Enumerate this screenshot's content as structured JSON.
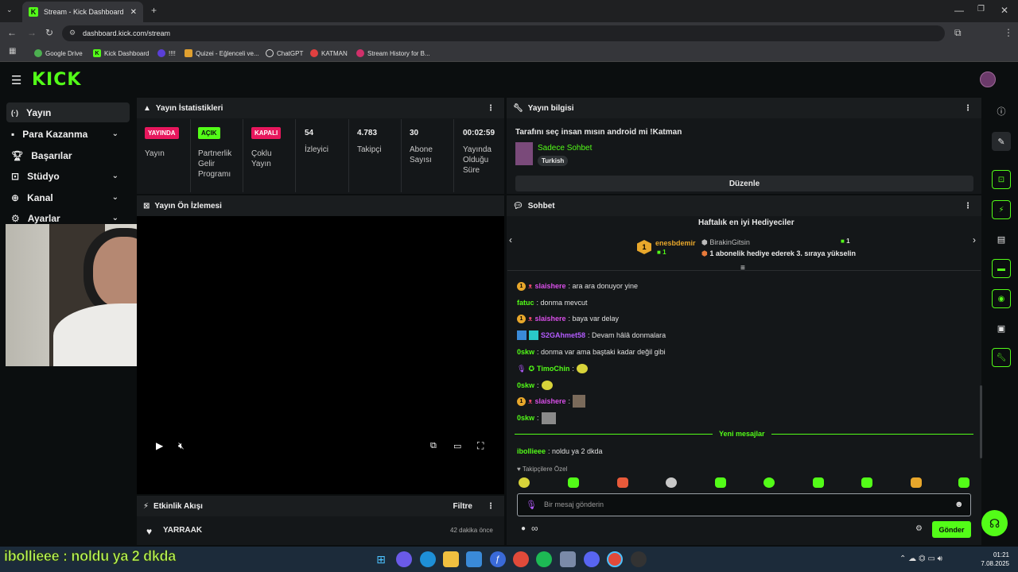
{
  "browser": {
    "tab_title": "Stream - Kick Dashboard",
    "url": "dashboard.kick.com/stream",
    "bookmarks": [
      "Google Drive",
      "Kick Dashboard",
      "!!!!",
      "Quizei - Eğlenceli ve...",
      "ChatGPT",
      "KATMAN",
      "Stream History for B..."
    ]
  },
  "sidebar": {
    "items": [
      {
        "label": "Yayın",
        "icon": "broadcast-icon"
      },
      {
        "label": "Para Kazanma",
        "icon": "money-icon"
      },
      {
        "label": "Başarılar",
        "icon": "trophy-icon"
      },
      {
        "label": "Stüdyo",
        "icon": "studio-icon"
      },
      {
        "label": "Kanal",
        "icon": "channel-icon"
      },
      {
        "label": "Ayarlar",
        "icon": "settings-icon"
      }
    ]
  },
  "stats": {
    "title": "Yayın İstatistikleri",
    "badges": [
      {
        "badge": "YAYINDA",
        "label": "Yayın",
        "color": "#e8175d"
      },
      {
        "badge": "AÇIK",
        "label": "Partnerlik Gelir Programı",
        "color": "#53fc18"
      },
      {
        "badge": "KAPALI",
        "label": "Çoklu Yayın",
        "color": "#e8175d"
      }
    ],
    "values": [
      {
        "value": "54",
        "label": "İzleyici"
      },
      {
        "value": "4.783",
        "label": "Takipçi"
      },
      {
        "value": "30",
        "label": "Abone Sayısı"
      },
      {
        "value": "00:02:59",
        "label": "Yayında Olduğu Süre"
      }
    ]
  },
  "preview": {
    "title": "Yayın Ön İzlemesi"
  },
  "activity": {
    "title": "Etkinlik Akışı",
    "filter": "Filtre",
    "item_user": "YARRAAK",
    "item_time": "42 dakika önce"
  },
  "info": {
    "title": "Yayın bilgisi",
    "stream_title": "Tarafını seç insan mısın android mi !Katman",
    "category": "Sadece Sohbet",
    "tag": "Turkish",
    "edit": "Düzenle"
  },
  "chat": {
    "title": "Sohbet",
    "gifters_title": "Haftalık en iyi Hediyeciler",
    "top_gifter": "enesbdemir",
    "top_count": "1",
    "second_gifter": "BirakinGitsin",
    "second_count": "1",
    "second_note": "1 abonelik hediye ederek 3. sıraya yükselin",
    "messages": [
      {
        "user": "slaishere",
        "text": ": ara ara donuyor yine",
        "color": "#d84ee8"
      },
      {
        "user": "fatuc",
        "text": ": donma mevcut",
        "color": "#53fc18"
      },
      {
        "user": "slaishere",
        "text": ": baya var delay",
        "color": "#d84ee8"
      },
      {
        "user": "S2GAhmet58",
        "text": ": Devam hâlâ donmalara",
        "color": "#b45cff"
      },
      {
        "user": "0skw",
        "text": ": donma var ama baştaki kadar değil gibi",
        "color": "#53fc18"
      },
      {
        "user": "TimoChin",
        "text": ":",
        "color": "#53fc18"
      },
      {
        "user": "0skw",
        "text": ":",
        "color": "#53fc18"
      },
      {
        "user": "slaishere",
        "text": ":",
        "color": "#d84ee8"
      },
      {
        "user": "0skw",
        "text": ":",
        "color": "#53fc18"
      }
    ],
    "new_messages": "Yeni mesajlar",
    "last_user": "ibollieee",
    "last_text": ": noldu ya 2 dkda",
    "followers_only": "Takipçilere Özel",
    "placeholder": "Bir mesaj gönderin",
    "send": "Gönder"
  },
  "overlay_text": "ibollieee : noldu ya 2 dkda",
  "clock": {
    "time": "01:21",
    "date": "7.08.2025"
  }
}
